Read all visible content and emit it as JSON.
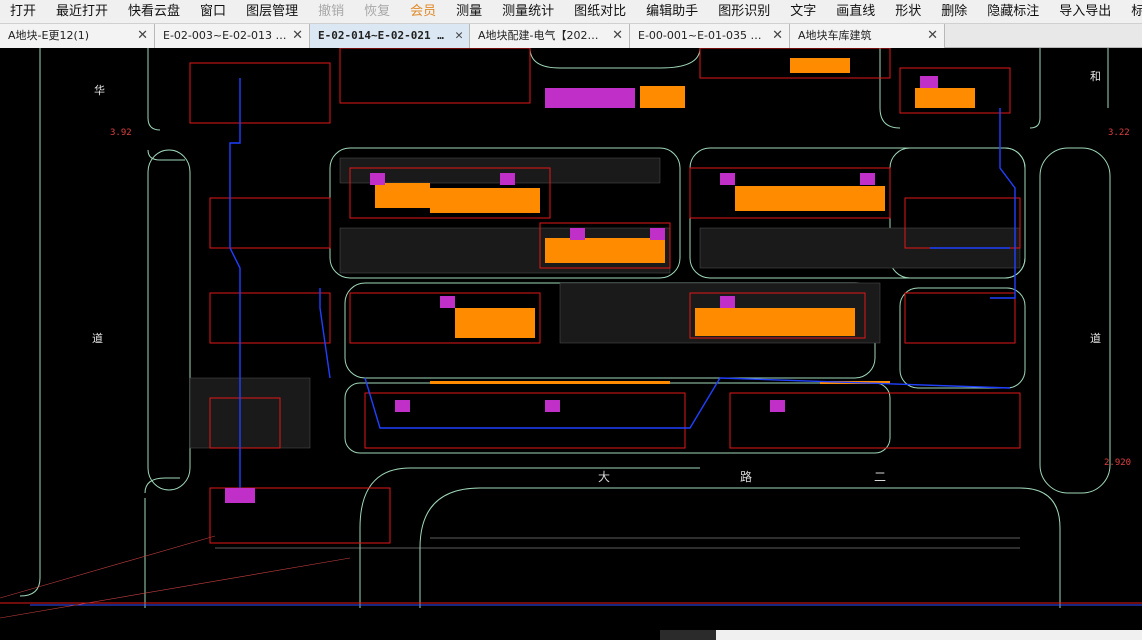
{
  "menu": {
    "items": [
      "打开",
      "最近打开",
      "快看云盘",
      "窗口",
      "图层管理",
      "撤销",
      "恢复",
      "会员",
      "测量",
      "测量统计",
      "图纸对比",
      "编辑助手",
      "图形识别",
      "文字",
      "画直线",
      "形状",
      "删除",
      "隐藏标注",
      "导入导出",
      "标注"
    ]
  },
  "tabs": [
    {
      "label": "A地块-E更12(1)",
      "close": "✕"
    },
    {
      "label": "E-02-003~E-02-013 …",
      "close": "✕"
    },
    {
      "label": "E-02-014~E-02-021 …",
      "close": "✕"
    },
    {
      "label": "A地块配建-电气【202…",
      "close": "✕"
    },
    {
      "label": "E-00-001~E-01-035 …",
      "close": "✕"
    },
    {
      "label": "A地块车库建筑",
      "close": "✕"
    }
  ],
  "drawing": {
    "label_hua": "华",
    "label_he": "和",
    "label_dao_left": "道",
    "label_dao_right": "道",
    "label_da": "大",
    "label_lu": "路",
    "label_er": "二",
    "elev_left": "3.92",
    "elev_right": "3.22",
    "elev_bottom": "2.920"
  },
  "colors": {
    "background": "#000000",
    "building_orange": "#ff8c00",
    "magenta": "#e030e0",
    "blue_route": "#2040ff",
    "red_line": "#e01818",
    "road_outline": "#9fd7b8"
  }
}
